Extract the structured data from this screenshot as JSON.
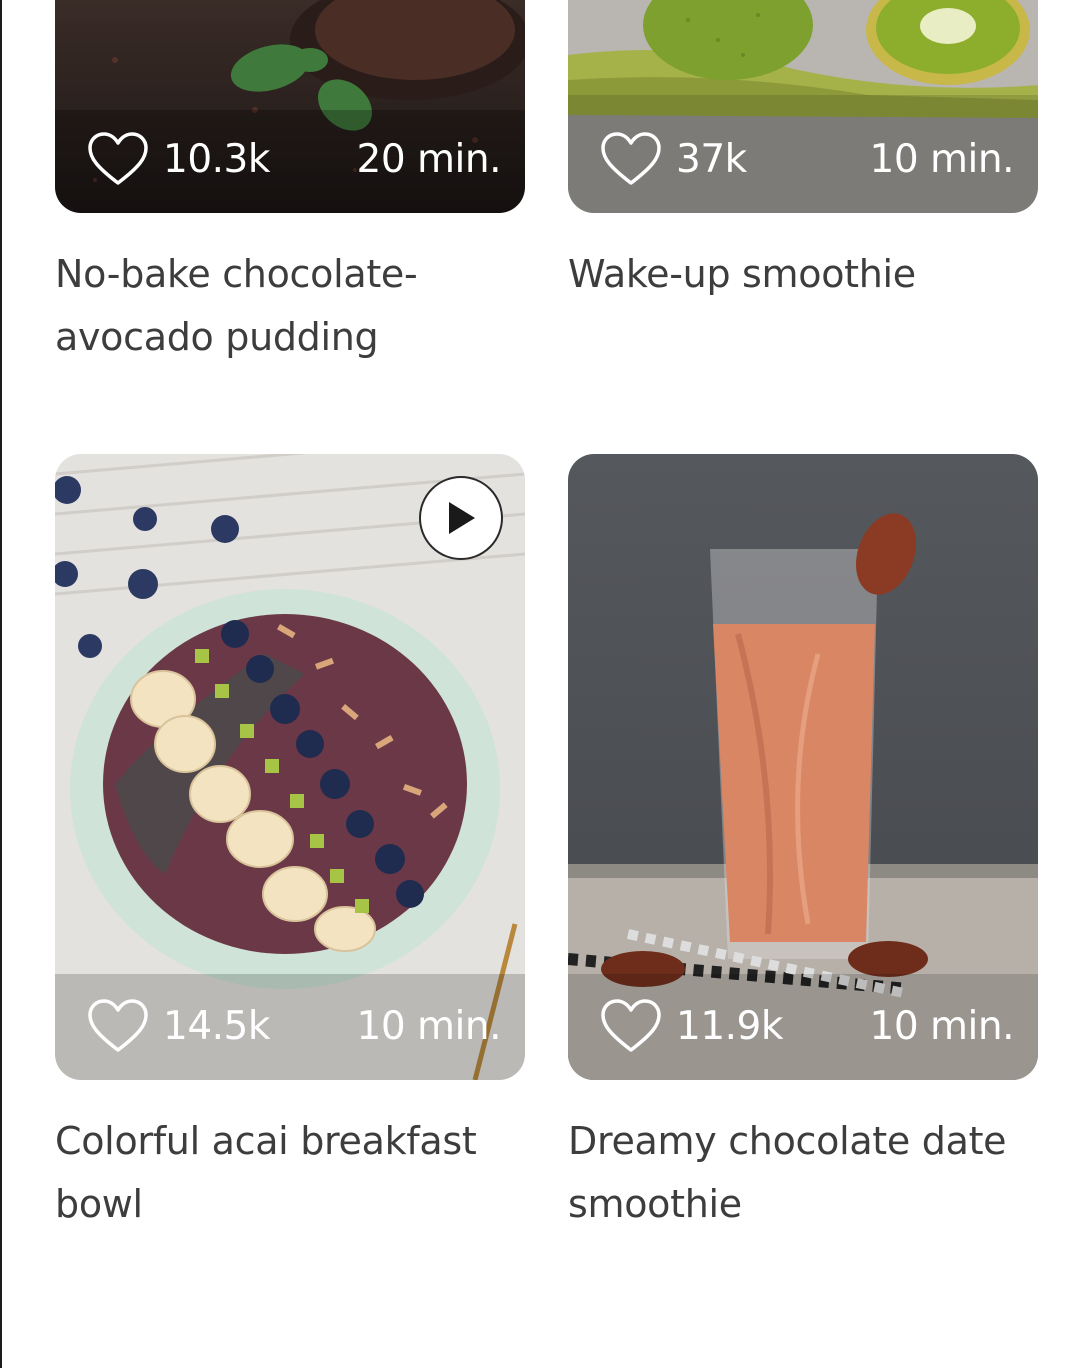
{
  "recipes": [
    {
      "title": "No-bake chocolate-avocado pudding",
      "likes": "10.3k",
      "time": "20 min.",
      "icon": "heart-outline-icon"
    },
    {
      "title": "Wake-up smoothie",
      "likes": "37k",
      "time": "10 min.",
      "icon": "heart-outline-icon"
    },
    {
      "title": "Colorful acai breakfast bowl",
      "likes": "14.5k",
      "time": "10 min.",
      "icon": "heart-outline-icon",
      "has_video": true
    },
    {
      "title": "Dreamy chocolate date smoothie",
      "likes": "11.9k",
      "time": "10 min.",
      "icon": "heart-outline-icon"
    }
  ],
  "colors": {
    "text": "#3d3d3d",
    "overlay_text": "#ffffff",
    "background": "#ffffff"
  }
}
